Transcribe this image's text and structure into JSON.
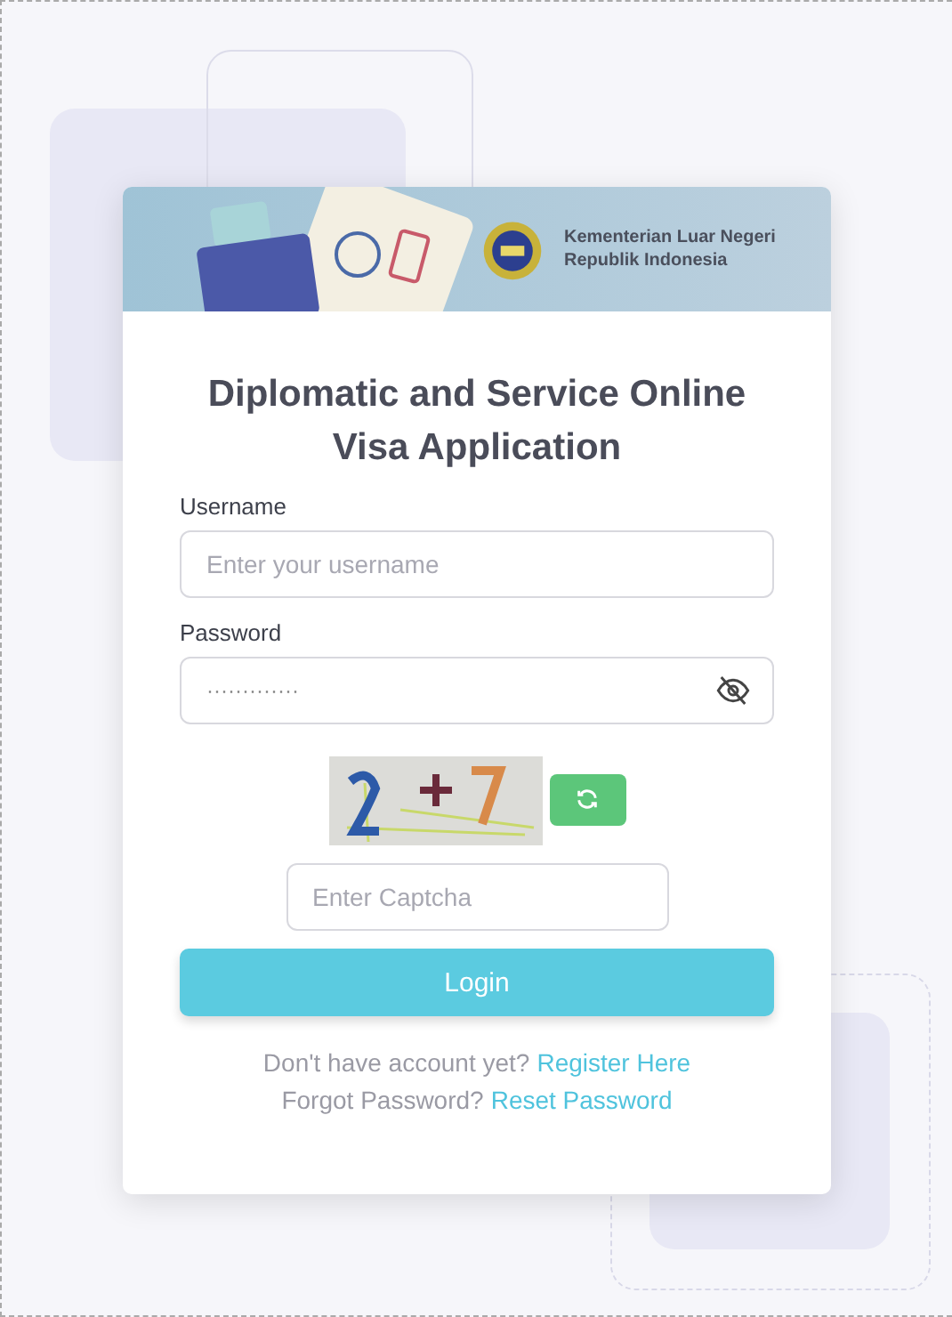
{
  "header": {
    "ministry_name": "Kementerian Luar Negeri",
    "ministry_country": "Republik Indonesia"
  },
  "title": "Diplomatic and Service Online Visa Application",
  "username": {
    "label": "Username",
    "placeholder": "Enter your username"
  },
  "password": {
    "label": "Password",
    "value": "·············"
  },
  "captcha": {
    "placeholder": "Enter Captcha"
  },
  "login_button": "Login",
  "links": [
    {
      "text": "Don't have account yet?",
      "link": "Register Here"
    },
    {
      "text": "Forgot Password?",
      "link": "Reset Password"
    }
  ]
}
